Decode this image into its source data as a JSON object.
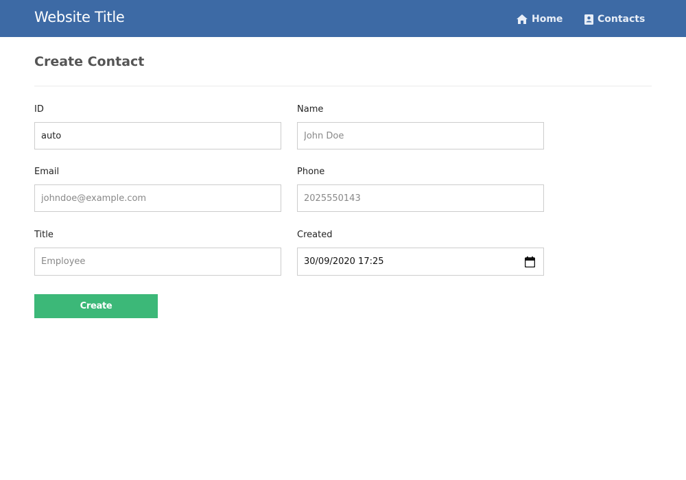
{
  "header": {
    "site_title": "Website Title",
    "nav": [
      {
        "label": "Home",
        "icon": "home-icon"
      },
      {
        "label": "Contacts",
        "icon": "address-book-icon"
      }
    ],
    "bg_color": "#3d6aa5"
  },
  "page": {
    "heading": "Create Contact"
  },
  "form": {
    "id": {
      "label": "ID",
      "value": "auto",
      "placeholder": ""
    },
    "name": {
      "label": "Name",
      "value": "",
      "placeholder": "John Doe"
    },
    "email": {
      "label": "Email",
      "value": "",
      "placeholder": "johndoe@example.com"
    },
    "phone": {
      "label": "Phone",
      "value": "",
      "placeholder": "2025550143"
    },
    "title": {
      "label": "Title",
      "value": "",
      "placeholder": "Employee"
    },
    "created": {
      "label": "Created",
      "value": "30/09/2020 17:25",
      "icon": "calendar-icon"
    },
    "submit_label": "Create",
    "submit_color": "#3cb878"
  }
}
